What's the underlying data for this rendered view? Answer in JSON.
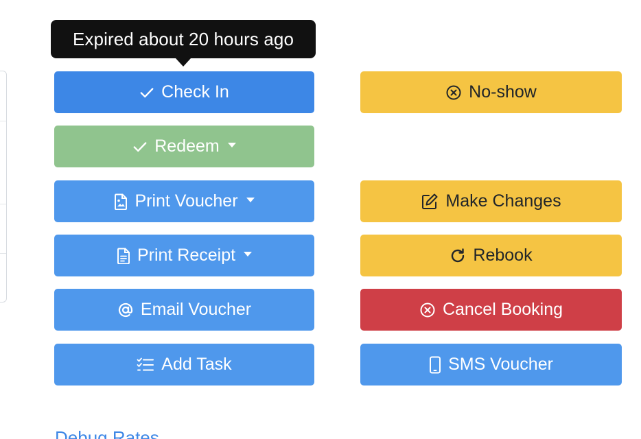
{
  "tooltip": {
    "text": "Expired about 20 hours ago"
  },
  "actions": {
    "check_in": {
      "label": "Check In",
      "icon": "check-icon"
    },
    "redeem": {
      "label": "Redeem",
      "icon": "check-icon"
    },
    "print_voucher": {
      "label": "Print Voucher",
      "icon": "image-file-icon"
    },
    "print_receipt": {
      "label": "Print Receipt",
      "icon": "document-icon"
    },
    "email_voucher": {
      "label": "Email Voucher",
      "icon": "at-sign-icon"
    },
    "add_task": {
      "label": "Add Task",
      "icon": "task-list-icon"
    },
    "no_show": {
      "label": "No-show",
      "icon": "x-circle-icon"
    },
    "make_changes": {
      "label": "Make Changes",
      "icon": "edit-icon"
    },
    "rebook": {
      "label": "Rebook",
      "icon": "rotate-icon"
    },
    "cancel_booking": {
      "label": "Cancel Booking",
      "icon": "x-circle-icon"
    },
    "sms_voucher": {
      "label": "SMS Voucher",
      "icon": "phone-icon"
    }
  },
  "debug_link": {
    "label": "Debug Rates"
  },
  "colors": {
    "primary": "#3d87e6",
    "info": "#4f98ec",
    "success": "#90c48e",
    "warning": "#f5c443",
    "danger": "#cf3f47",
    "tooltip": "#111111"
  }
}
